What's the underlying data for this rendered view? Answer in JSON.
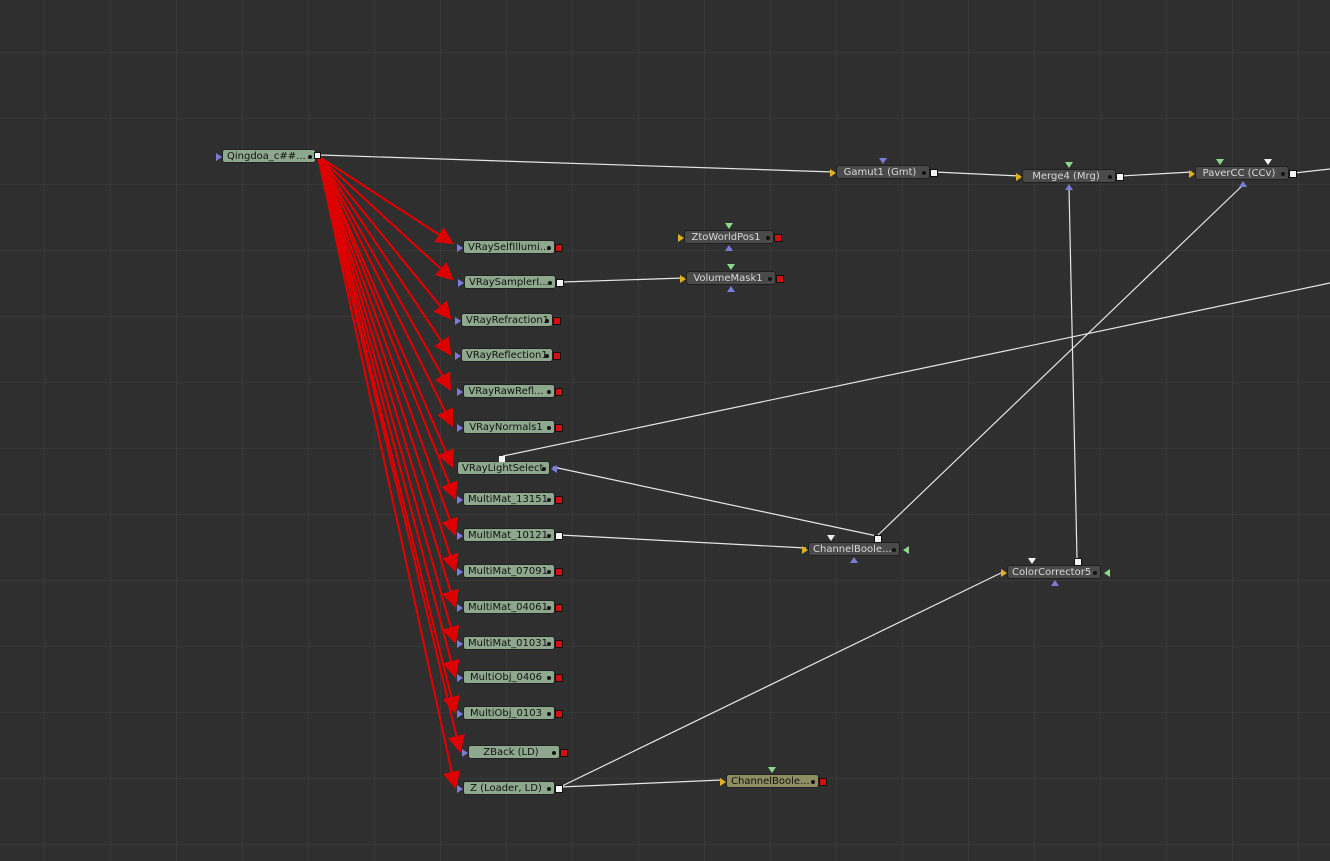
{
  "flow": {
    "colors": {
      "background": "#2f2f2f",
      "grid": "#383838",
      "loader_node": "#8ea88e",
      "tool_node": "#4a4a4a",
      "highlight_node": "#8e8e62",
      "red_connection": "#dd0000",
      "white_connection": "#e6e6e6"
    },
    "nodes": {
      "qingdoa": "Qingdoa_c##...",
      "gamut1": "Gamut1  (Gmt)",
      "merge4": "Merge4  (Mrg)",
      "paver_cc": "PaverCC  (CCv)",
      "zto_world_pos1": "ZtoWorldPos1",
      "volume_mask1": "VolumeMask1",
      "vray_self_illum": "VRaySelfIllumi...",
      "vray_sampler": "VRaySamplerI...",
      "vray_refraction1": "VRayRefraction1",
      "vray_reflection1": "VRayReflection1",
      "vray_raw_refl": "VRayRawRefl...",
      "vray_normals1": "VRayNormals1",
      "vray_light_select": "VRayLightSelect",
      "multimat_13151": "MultiMat_13151",
      "multimat_10121": "MultiMat_10121",
      "multimat_07091": "MultiMat_07091",
      "multimat_04061": "MultiMat_04061",
      "multimat_01031": "MultiMat_01031",
      "multiobj_0406": "MultiObj_0406",
      "multiobj_0103": "MultiObj_0103",
      "zback": "ZBack  (LD)",
      "z_loader": "Z  (Loader, LD)",
      "channel_boole_1": "ChannelBoole...",
      "color_corrector5": "ColorCorrector5",
      "channel_boole_2": "ChannelBoole..."
    }
  }
}
